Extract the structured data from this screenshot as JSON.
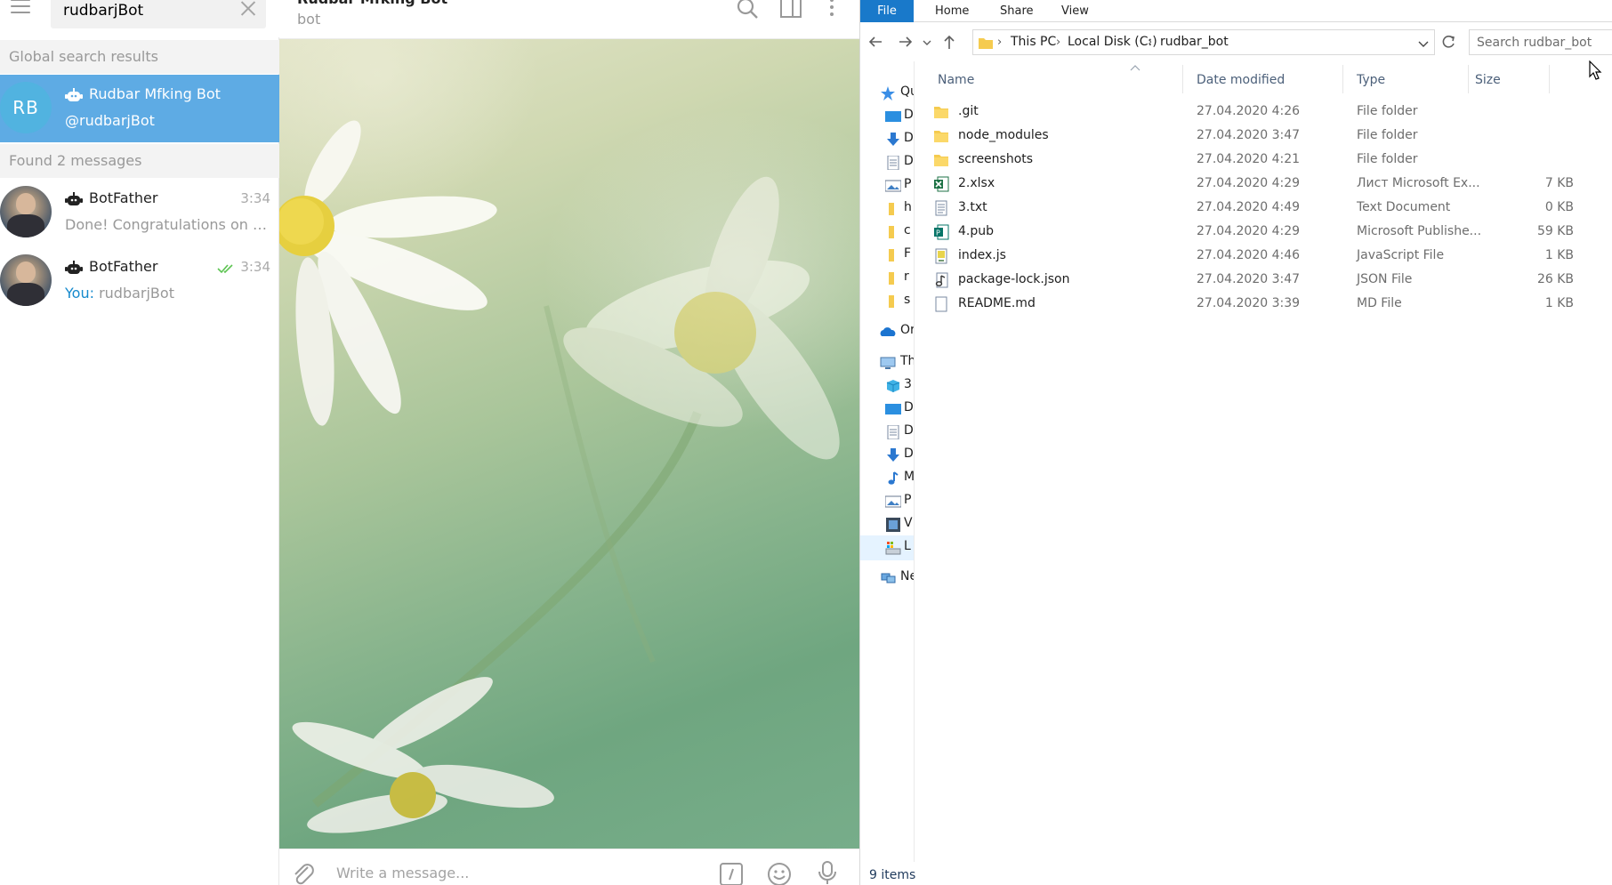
{
  "telegram": {
    "search": {
      "value": "rudbarjBot"
    },
    "sections": {
      "global": "Global search results",
      "found": "Found 2 messages"
    },
    "global_result": {
      "avatar_initials": "RB",
      "avatar_color": "#51b3e0",
      "name": "Rudbar Mfking Bot",
      "username": "@rudbarjBot",
      "icon": "bot-icon"
    },
    "messages": [
      {
        "name": "BotFather",
        "time": "3:34",
        "preview": "Done! Congratulations on yo...",
        "you_prefix": "",
        "read_check": false
      },
      {
        "name": "BotFather",
        "time": "3:34",
        "preview": "rudbarjBot",
        "you_prefix": "You:",
        "read_check": true
      }
    ],
    "chat": {
      "title": "Rudbar Mfking Bot",
      "status": "bot",
      "header_icons": [
        "search-icon",
        "sidebar-toggle-icon",
        "more-vertical-icon"
      ]
    },
    "composer": {
      "placeholder": "Write a message...",
      "icons": [
        "attach-icon",
        "bot-command-icon",
        "emoji-icon",
        "microphone-icon"
      ]
    },
    "colors": {
      "accent": "#5eabe4",
      "link": "#168acd"
    }
  },
  "explorer": {
    "ribbon_tabs": [
      "File",
      "Home",
      "Share",
      "View"
    ],
    "breadcrumb": [
      "This PC",
      "Local Disk (C:)",
      "rudbar_bot"
    ],
    "search_placeholder": "Search rudbar_bot",
    "columns": {
      "name": "Name",
      "date": "Date modified",
      "type": "Type",
      "size": "Size"
    },
    "sidebar": [
      {
        "icon": "star-icon",
        "label": "Qu",
        "level": "top"
      },
      {
        "icon": "desktop-icon",
        "label": "D",
        "level": "sub"
      },
      {
        "icon": "download-icon",
        "label": "D",
        "level": "sub"
      },
      {
        "icon": "document-icon",
        "label": "D",
        "level": "sub"
      },
      {
        "icon": "picture-icon",
        "label": "P",
        "level": "sub"
      },
      {
        "icon": "folder-icon",
        "label": "h",
        "level": "sub"
      },
      {
        "icon": "folder-icon",
        "label": "c",
        "level": "sub"
      },
      {
        "icon": "folder-icon",
        "label": "F",
        "level": "sub"
      },
      {
        "icon": "folder-icon",
        "label": "r",
        "level": "sub"
      },
      {
        "icon": "folder-icon",
        "label": "s",
        "level": "sub"
      },
      {
        "icon": "onedrive-icon",
        "label": "Or",
        "level": "top"
      },
      {
        "icon": "this-pc-icon",
        "label": "Th",
        "level": "top"
      },
      {
        "icon": "3d-objects-icon",
        "label": "3",
        "level": "sub"
      },
      {
        "icon": "desktop-icon",
        "label": "D",
        "level": "sub"
      },
      {
        "icon": "document-icon",
        "label": "D",
        "level": "sub"
      },
      {
        "icon": "download-icon",
        "label": "D",
        "level": "sub"
      },
      {
        "icon": "music-icon",
        "label": "M",
        "level": "sub"
      },
      {
        "icon": "picture-icon",
        "label": "P",
        "level": "sub"
      },
      {
        "icon": "video-icon",
        "label": "V",
        "level": "sub"
      },
      {
        "icon": "local-disk-icon",
        "label": "L",
        "level": "sub",
        "selected": true
      },
      {
        "icon": "network-icon",
        "label": "Ne",
        "level": "top"
      }
    ],
    "files": [
      {
        "icon": "folder-icon",
        "name": ".git",
        "date": "27.04.2020 4:26",
        "type": "File folder",
        "size": ""
      },
      {
        "icon": "folder-icon",
        "name": "node_modules",
        "date": "27.04.2020 3:47",
        "type": "File folder",
        "size": ""
      },
      {
        "icon": "folder-icon",
        "name": "screenshots",
        "date": "27.04.2020 4:21",
        "type": "File folder",
        "size": ""
      },
      {
        "icon": "excel-icon",
        "name": "2.xlsx",
        "date": "27.04.2020 4:29",
        "type": "Лист Microsoft Ex...",
        "size": "7 KB"
      },
      {
        "icon": "text-file-icon",
        "name": "3.txt",
        "date": "27.04.2020 4:49",
        "type": "Text Document",
        "size": "0 KB"
      },
      {
        "icon": "publisher-icon",
        "name": "4.pub",
        "date": "27.04.2020 4:29",
        "type": "Microsoft Publishe...",
        "size": "59 KB"
      },
      {
        "icon": "js-file-icon",
        "name": "index.js",
        "date": "27.04.2020 4:46",
        "type": "JavaScript File",
        "size": "1 KB"
      },
      {
        "icon": "json-file-icon",
        "name": "package-lock.json",
        "date": "27.04.2020 3:47",
        "type": "JSON File",
        "size": "26 KB"
      },
      {
        "icon": "blank-file-icon",
        "name": "README.md",
        "date": "27.04.2020 3:39",
        "type": "MD File",
        "size": "1 KB"
      }
    ],
    "status": "9 items",
    "colors": {
      "file_tab": "#1979ca",
      "folder": "#f5cb4f"
    }
  }
}
